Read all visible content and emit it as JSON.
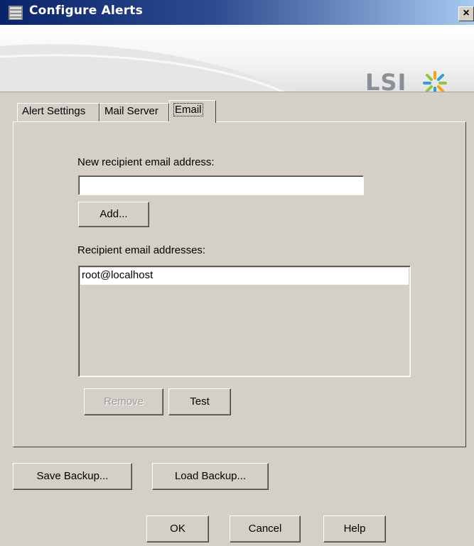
{
  "window": {
    "title": "Configure Alerts",
    "close_glyph": "×"
  },
  "banner": {
    "logo_text": "LSI",
    "logo_icon": "lsi-starburst-icon"
  },
  "tabs": [
    {
      "label": "Alert Settings",
      "active": false
    },
    {
      "label": "Mail Server",
      "active": false
    },
    {
      "label": "Email",
      "active": true
    }
  ],
  "email_tab": {
    "new_label": "New recipient email address:",
    "new_value": "",
    "add_button": "Add...",
    "recipients_label": "Recipient email addresses:",
    "recipients": [
      "root@localhost"
    ],
    "remove_button": "Remove",
    "remove_enabled": false,
    "test_button": "Test"
  },
  "backup": {
    "save": "Save Backup...",
    "load": "Load Backup..."
  },
  "footer": {
    "ok": "OK",
    "cancel": "Cancel",
    "help": "Help"
  },
  "colors": {
    "dialog": "#d4d0c8",
    "title_start": "#0a246a",
    "title_end": "#a6caf0",
    "logo_gray": "#8a9099"
  }
}
